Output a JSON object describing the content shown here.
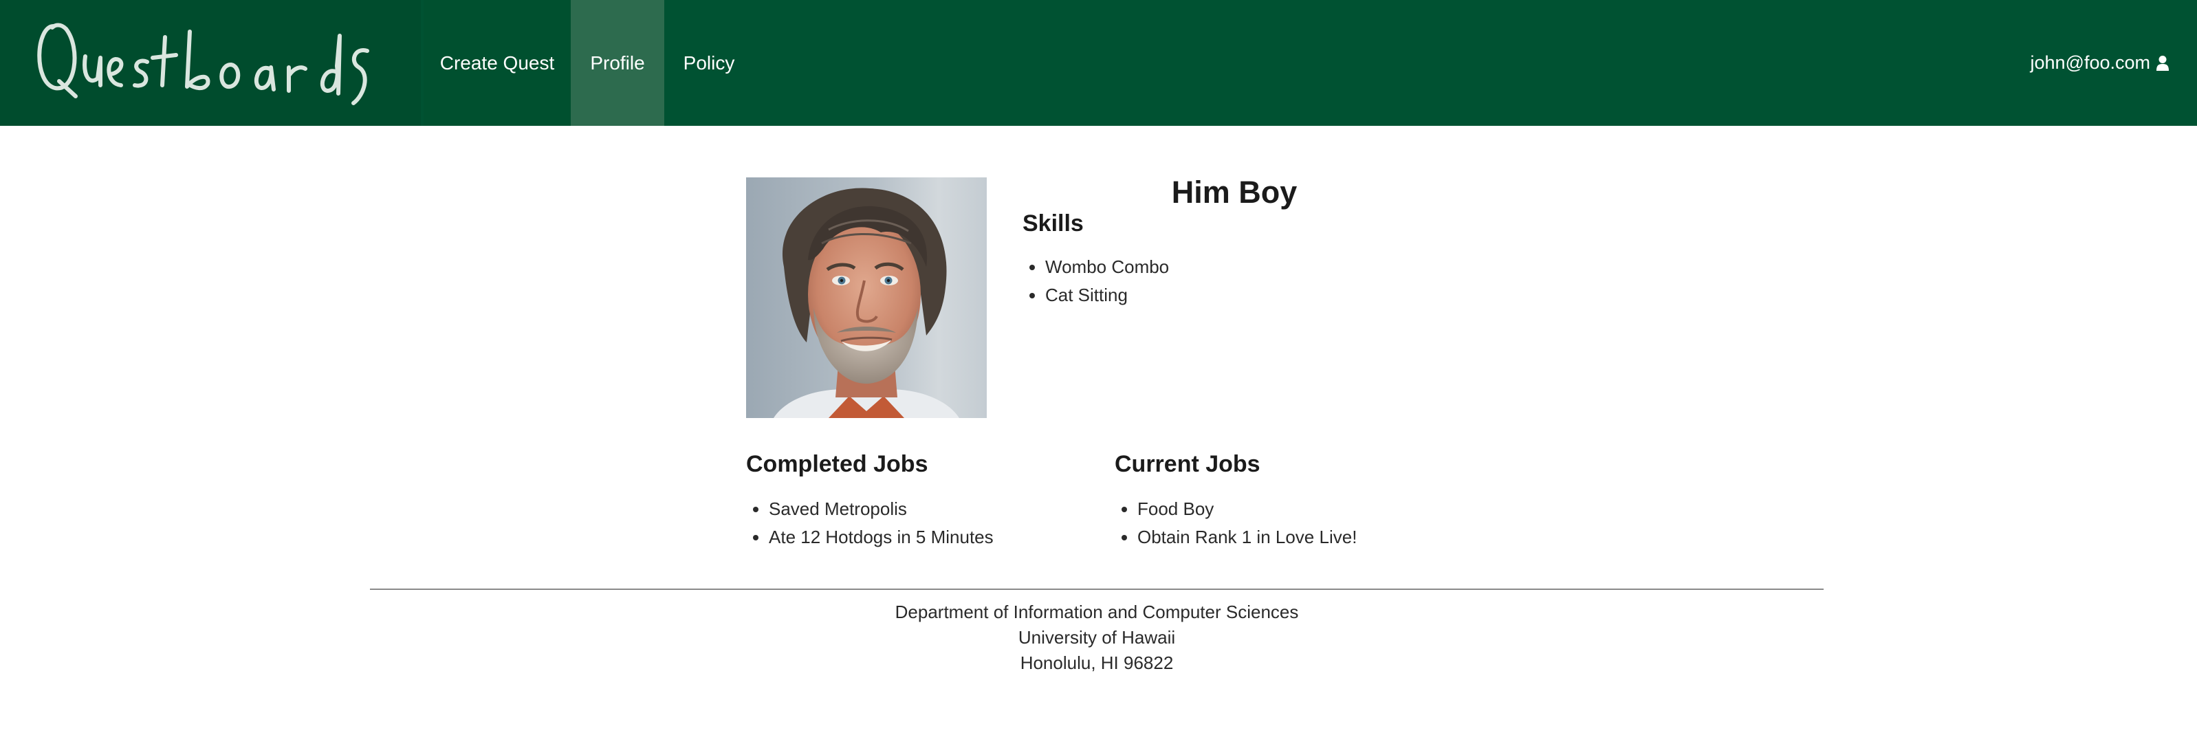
{
  "navbar": {
    "brand": "Questboards",
    "items": [
      {
        "label": "Create Quest"
      },
      {
        "label": "Profile",
        "active": true
      },
      {
        "label": "Policy"
      }
    ],
    "user_email": "john@foo.com",
    "user_icon": "user-icon"
  },
  "profile": {
    "name": "Him Boy",
    "photo": "profile-photo",
    "skills_heading": "Skills",
    "skills": [
      "Wombo Combo",
      "Cat Sitting"
    ],
    "completed_heading": "Completed Jobs",
    "completed": [
      "Saved Metropolis",
      "Ate 12 Hotdogs in 5 Minutes"
    ],
    "current_heading": "Current Jobs",
    "current": [
      "Food Boy",
      "Obtain Rank 1 in Love Live!"
    ]
  },
  "footer": {
    "line1": "Department of Information and Computer Sciences",
    "line2": "University of Hawaii",
    "line3": "Honolulu, HI 96822"
  },
  "colors": {
    "navbar": "#005232",
    "nav_active": "#2d6b4e",
    "brand_bg": "#004c2d"
  }
}
